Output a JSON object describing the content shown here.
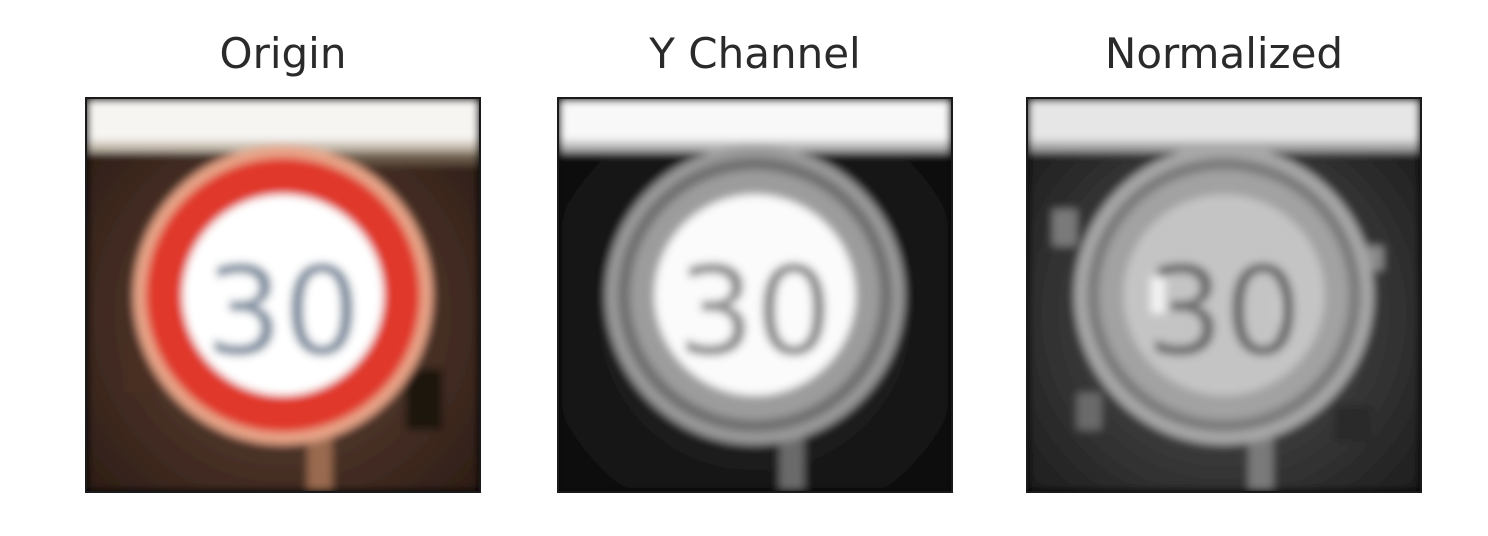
{
  "figure": {
    "panels": [
      {
        "title": "Origin",
        "sign_text": "30"
      },
      {
        "title": "Y Channel",
        "sign_text": "30"
      },
      {
        "title": "Normalized",
        "sign_text": "30"
      }
    ]
  }
}
